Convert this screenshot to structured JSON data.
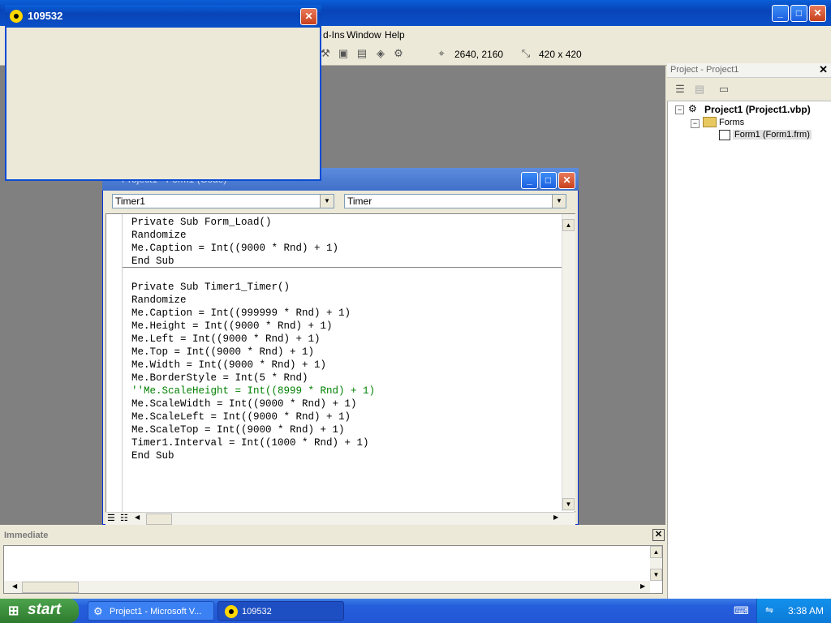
{
  "ide": {
    "menu_visible": [
      "d-Ins",
      "Window",
      "Help"
    ],
    "toolbar_coords": "2640, 2160",
    "toolbar_size": "420 x 420"
  },
  "form_window": {
    "title": "109532"
  },
  "code_window": {
    "title": "Project1 - Form1 (Code)",
    "object_combo": "Timer1",
    "procedure_combo": "Timer",
    "lines": [
      "Private Sub Form_Load()",
      "Randomize",
      "Me.Caption = Int((9000 * Rnd) + 1)",
      "End Sub",
      "",
      "Private Sub Timer1_Timer()",
      "Randomize",
      "Me.Caption = Int((999999 * Rnd) + 1)",
      "Me.Height = Int((9000 * Rnd) + 1)",
      "Me.Left = Int((9000 * Rnd) + 1)",
      "Me.Top = Int((9000 * Rnd) + 1)",
      "Me.Width = Int((9000 * Rnd) + 1)",
      "Me.BorderStyle = Int(5 * Rnd)",
      "''Me.ScaleHeight = Int((8999 * Rnd) + 1)",
      "Me.ScaleWidth = Int((9000 * Rnd) + 1)",
      "Me.ScaleLeft = Int((9000 * Rnd) + 1)",
      "Me.ScaleTop = Int((9000 * Rnd) + 1)",
      "Timer1.Interval = Int((1000 * Rnd) + 1)",
      "End Sub"
    ]
  },
  "project_panel": {
    "title": "Project - Project1",
    "tree": {
      "root": "Project1 (Project1.vbp)",
      "folder": "Forms",
      "item": "Form1 (Form1.frm)"
    }
  },
  "immediate": {
    "title": "Immediate"
  },
  "taskbar": {
    "start_label": "start",
    "tasks": [
      "Project1 - Microsoft V...",
      "109532"
    ],
    "clock": "3:38 AM"
  },
  "colors": {
    "xp_blue": "#0a50c8",
    "code_comment": "#008000",
    "desktop_gray": "#808080"
  }
}
